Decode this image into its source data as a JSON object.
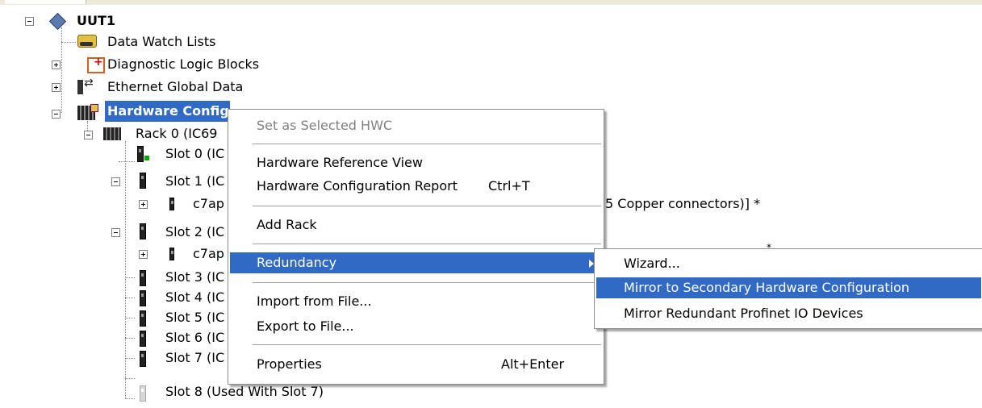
{
  "tree": {
    "root": {
      "label": "UUT1"
    },
    "data_watch": {
      "label": "Data Watch Lists"
    },
    "diag_blocks": {
      "label": "Diagnostic Logic Blocks"
    },
    "egd": {
      "label": "Ethernet Global Data"
    },
    "hwc": {
      "label": "Hardware Configuration [Primary]*"
    },
    "rack0": {
      "label": "Rack 0 (IC69"
    },
    "slots": [
      {
        "label": "Slot 0 (IC"
      },
      {
        "label": "Slot 1 (IC"
      },
      {
        "label": "c7ap"
      },
      {
        "label": "Slot 2 (IC"
      },
      {
        "label": "c7ap"
      },
      {
        "label": "Slot 3 (IC"
      },
      {
        "label": "Slot 4 (IC"
      },
      {
        "label": "Slot 5 (IC"
      },
      {
        "label": "Slot 6 (IC"
      },
      {
        "label": "Slot 7 (IC"
      },
      {
        "label": "Slot 8 (Used With Slot 7)"
      }
    ],
    "slot1_child_suffix": "5 Copper connectors)] *",
    "slot2_child_suffix": "*"
  },
  "context_menu": {
    "set_selected": "Set as Selected HWC",
    "hw_ref_view": "Hardware Reference View",
    "hw_config_report": "Hardware Configuration Report",
    "hw_config_report_shortcut": "Ctrl+T",
    "add_rack": "Add Rack",
    "redundancy": "Redundancy",
    "import_file": "Import from File...",
    "export_file": "Export to File...",
    "properties": "Properties",
    "properties_shortcut": "Alt+Enter"
  },
  "redundancy_submenu": {
    "wizard": "Wizard...",
    "mirror_secondary": "Mirror to Secondary Hardware Configuration",
    "mirror_profinet": "Mirror Redundant Profinet IO Devices"
  },
  "colors": {
    "selection": "#316ac5",
    "menu_border": "#8e8e8e"
  }
}
